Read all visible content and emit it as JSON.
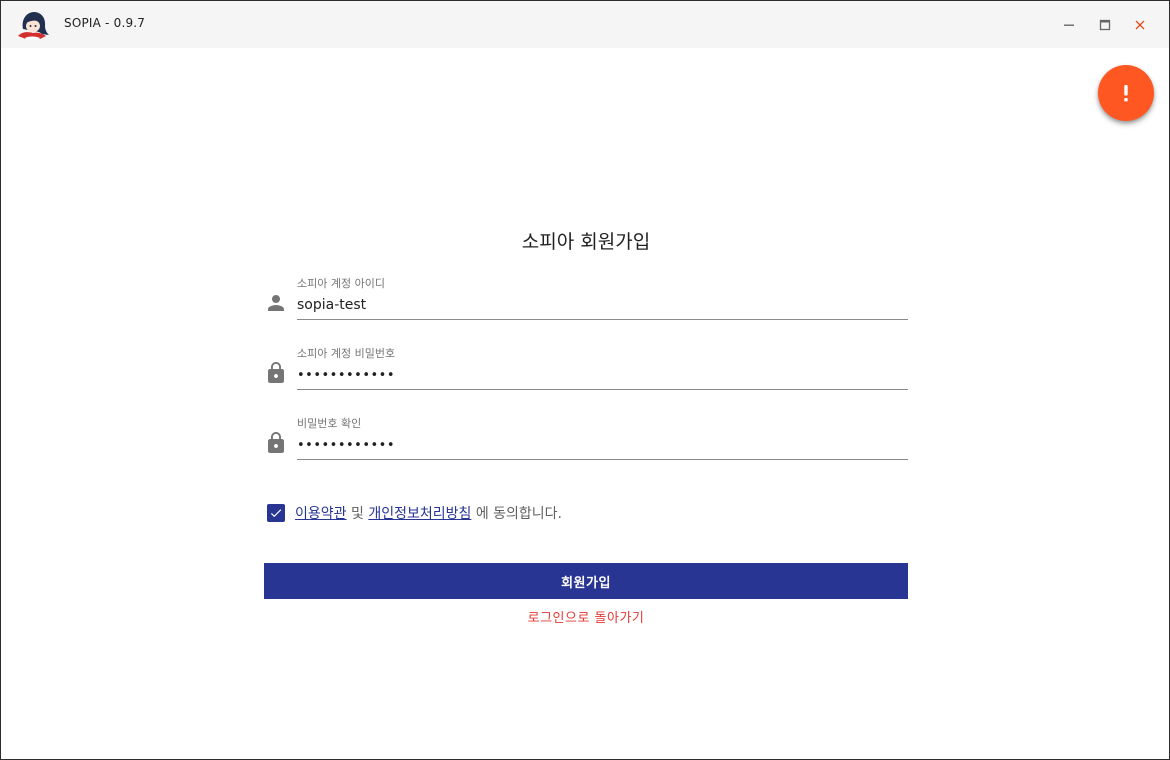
{
  "window": {
    "title": "SOPIA - 0.9.7",
    "logo_icon": "sopia-character-logo",
    "controls": {
      "minimize_icon": "minimize-icon",
      "maximize_icon": "maximize-icon",
      "close_icon": "close-icon"
    }
  },
  "fab": {
    "icon": "exclamation-icon",
    "color": "#ff5722"
  },
  "form": {
    "title": "소피아 회원가입",
    "fields": [
      {
        "label": "소피아 계정 아이디",
        "value": "sopia-test",
        "icon": "person-icon"
      },
      {
        "label": "소피아 계정 비밀번호",
        "value": "••••••••••••",
        "icon": "lock-icon"
      },
      {
        "label": "비밀번호 확인",
        "value": "••••••••••••",
        "icon": "lock-icon"
      }
    ],
    "agreement": {
      "checked": true,
      "terms_link": "이용약관",
      "conjunction": "및",
      "privacy_link": "개인정보처리방침",
      "suffix": "에 동의합니다."
    },
    "submit_label": "회원가입",
    "back_label": "로그인으로 돌아가기"
  },
  "colors": {
    "primary": "#283593",
    "accent": "#ff5722",
    "link_red": "#e53935"
  }
}
